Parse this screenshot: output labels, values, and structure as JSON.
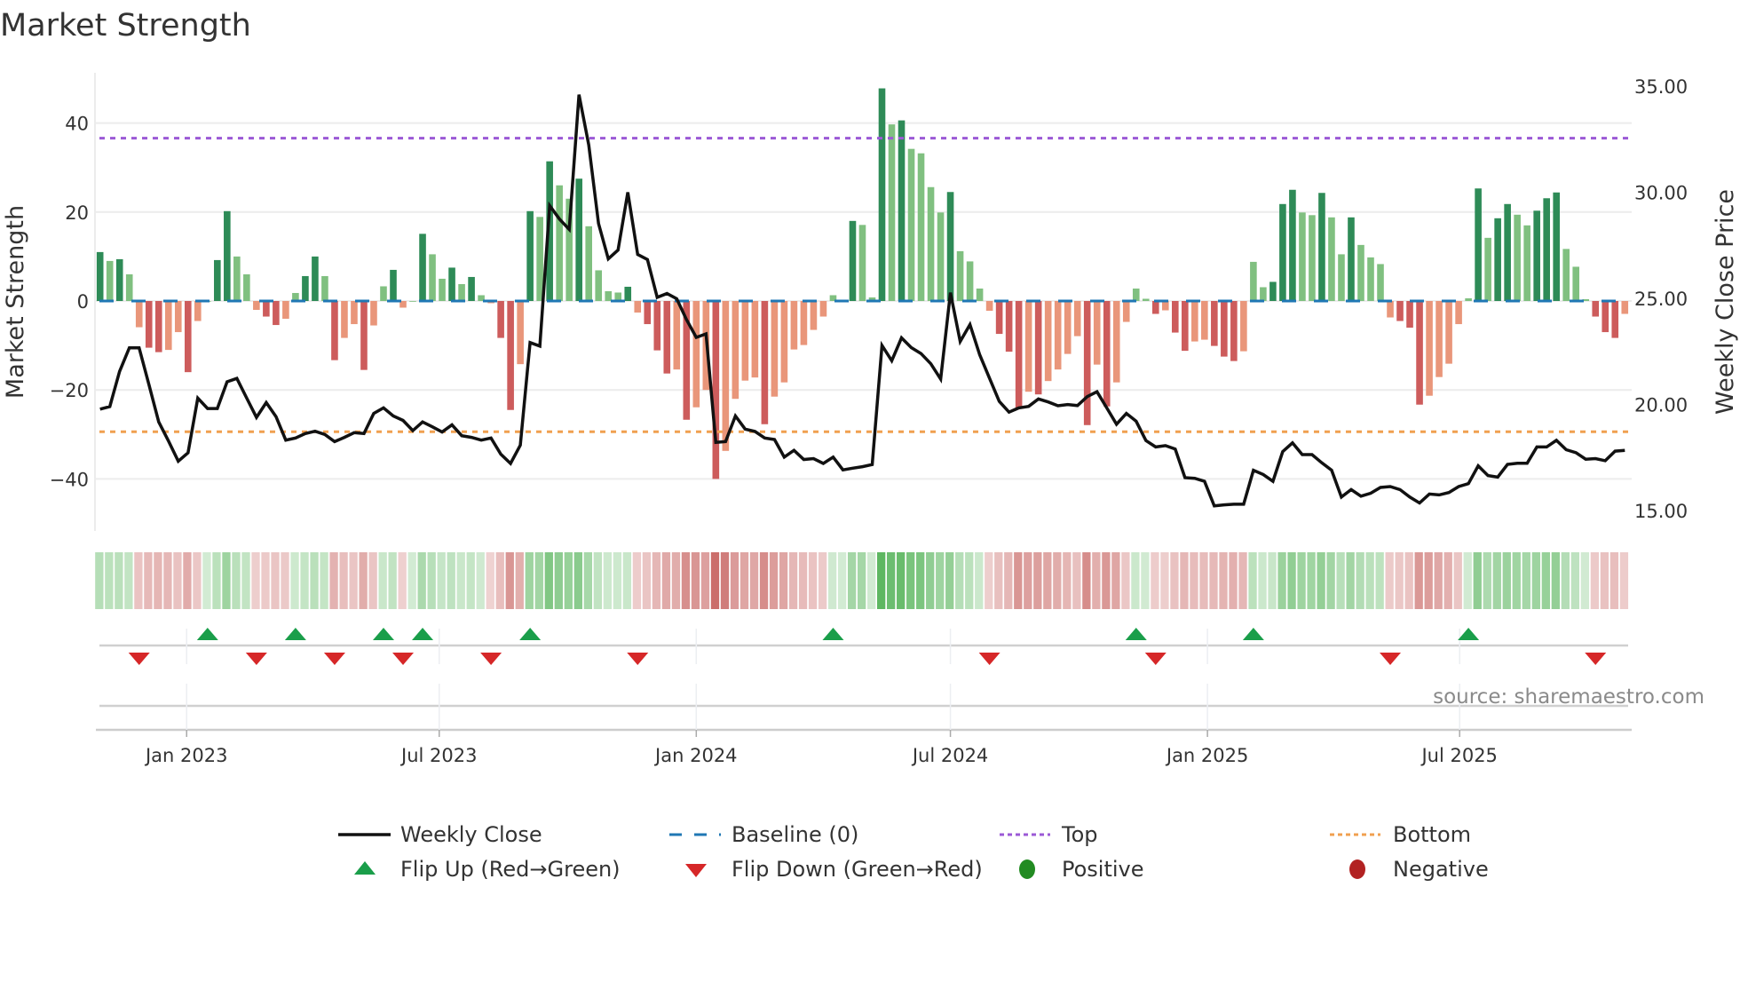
{
  "chart_data": {
    "type": "bar",
    "title": "Market Strength",
    "ylabel": "Market Strength",
    "y2label": "Weekly Close Price",
    "ylim": [
      -51.7,
      51.3
    ],
    "y2lim": [
      14.04,
      35.63
    ],
    "yticks": [
      "40",
      "20",
      "0",
      "−20",
      "−40"
    ],
    "ytick_values": [
      40,
      20,
      0,
      -20,
      -40
    ],
    "y2ticks": [
      "35.00",
      "30.00",
      "25.00",
      "20.00",
      "15.00"
    ],
    "y2tick_values": [
      35,
      30,
      25,
      20,
      15
    ],
    "x_start": "2022-10-31",
    "x_step": "weekly",
    "xticks": [
      {
        "label": "Jan 2023",
        "week": 8.86
      },
      {
        "label": "Jul 2023",
        "week": 34.7
      },
      {
        "label": "Jan 2024",
        "week": 61.0
      },
      {
        "label": "Jul 2024",
        "week": 87.0
      },
      {
        "label": "Jan 2025",
        "week": 113.3
      },
      {
        "label": "Jul 2025",
        "week": 139.1
      }
    ],
    "top_level": 36.6,
    "bottom_level": -29.4,
    "strength": [
      11,
      9,
      9.4,
      6,
      -5.9,
      -10.5,
      -11.5,
      -11,
      -7,
      -16,
      -4.5,
      0,
      9.2,
      20.2,
      10,
      6,
      -2,
      -3.5,
      -5.4,
      -4,
      1.8,
      5.6,
      10,
      5.6,
      -13.3,
      -8.3,
      -5.2,
      -15.5,
      -5.5,
      3.3,
      7,
      -1.5,
      0,
      15.1,
      10.5,
      5,
      7.5,
      3.8,
      5.4,
      1.3,
      -0.5,
      -8.3,
      -24.5,
      -14.2,
      20.2,
      18.9,
      31.4,
      26,
      23,
      27.5,
      16.8,
      6.9,
      2.2,
      1.9,
      3.2,
      -2.6,
      -5.2,
      -11.1,
      -16.3,
      -15.4,
      -26.7,
      -23.9,
      -20,
      -40,
      -33.7,
      -22,
      -17.9,
      -17.2,
      -27.7,
      -21.5,
      -18.3,
      -10.9,
      -9.9,
      -6.5,
      -3.5,
      1.3,
      0.3,
      18,
      17.1,
      0.8,
      47.8,
      39.7,
      40.6,
      34.2,
      33.2,
      25.6,
      19.9,
      24.5,
      11.2,
      8.9,
      2.8,
      -2.2,
      -7.4,
      -11.4,
      -24,
      -20.4,
      -21,
      -18,
      -15.4,
      -11.9,
      -7.9,
      -27.9,
      -14.3,
      -23.7,
      -18.3,
      -4.7,
      2.8,
      0.5,
      -2.9,
      -2.1,
      -7.1,
      -11.2,
      -9.1,
      -8.7,
      -10.1,
      -12.5,
      -13.5,
      -11.3,
      8.8,
      3.1,
      4.3,
      21.8,
      25,
      19.9,
      19.3,
      24.3,
      18.8,
      10.5,
      18.8,
      12.6,
      9.8,
      8.3,
      -3.7,
      -4.5,
      -6,
      -23.3,
      -21.3,
      -17.1,
      -14.1,
      -5.2,
      0.6,
      25.3,
      14.2,
      18.6,
      21.8,
      19.4,
      17,
      20.3,
      23.1,
      24.4,
      11.7,
      7.7,
      0.4,
      -3.5,
      -7,
      -8.3,
      -2.9
    ],
    "close": [
      19.78,
      19.9,
      21.56,
      22.67,
      22.67,
      20.93,
      19.18,
      18.28,
      17.33,
      17.72,
      20.3,
      19.81,
      19.81,
      21.07,
      21.23,
      20.3,
      19.39,
      20.09,
      19.43,
      18.32,
      18.42,
      18.63,
      18.74,
      18.59,
      18.25,
      18.45,
      18.67,
      18.63,
      19.58,
      19.84,
      19.46,
      19.25,
      18.77,
      19.18,
      18.95,
      18.7,
      19.04,
      18.53,
      18.45,
      18.32,
      18.42,
      17.66,
      17.22,
      18.08,
      22.92,
      22.75,
      29.37,
      28.74,
      28.25,
      34.6,
      32.23,
      28.53,
      26.86,
      27.28,
      30,
      27.07,
      26.83,
      25.05,
      25.23,
      24.98,
      24,
      23.16,
      23.33,
      18.21,
      18.25,
      19.46,
      18.84,
      18.73,
      18.42,
      18.35,
      17.52,
      17.84,
      17.41,
      17.45,
      17.22,
      17.52,
      16.92,
      17.0,
      17.07,
      17.17,
      22.78,
      22.06,
      23.14,
      22.68,
      22.4,
      21.92,
      21.2,
      25.27,
      22.97,
      23.77,
      22.34,
      21.24,
      20.15,
      19.64,
      19.84,
      19.91,
      20.26,
      20.12,
      19.94,
      20.0,
      19.95,
      20.37,
      20.6,
      19.84,
      19.07,
      19.58,
      19.21,
      18.3,
      18.0,
      18.06,
      17.9,
      16.55,
      16.52,
      16.38,
      15.22,
      15.27,
      15.3,
      15.3,
      16.9,
      16.7,
      16.38,
      17.78,
      18.19,
      17.64,
      17.64,
      17.25,
      16.9,
      15.64,
      15.99,
      15.68,
      15.82,
      16.09,
      16.13,
      15.99,
      15.64,
      15.36,
      15.78,
      15.74,
      15.85,
      16.13,
      16.27,
      17.11,
      16.65,
      16.58,
      17.18,
      17.23,
      17.23,
      18.0,
      18.0,
      18.31,
      17.87,
      17.73,
      17.42,
      17.45,
      17.35,
      17.8,
      17.84
    ],
    "flip_up_weeks": [
      11,
      20,
      29,
      33,
      44,
      75,
      106,
      118,
      140
    ],
    "flip_down_weeks": [
      4,
      16,
      24,
      31,
      40,
      55,
      91,
      108,
      132,
      153
    ],
    "legend": {
      "placement": "bottom",
      "weekly_close": "Weekly Close",
      "baseline": "Baseline (0)",
      "top": "Top",
      "bottom": "Bottom",
      "flip_up": "Flip Up (Red→Green)",
      "flip_down": "Flip Down (Green→Red)",
      "positive": "Positive",
      "negative": "Negative"
    },
    "source": "source: sharemaestro.com",
    "colors": {
      "pos_strong": "#2e8b57",
      "pos_weak": "#80c080",
      "neg_strong": "#cd5c5c",
      "neg_weak": "#e9967a",
      "baseline": "#1f77b4",
      "top": "#9b59d6",
      "bottom": "#f0a050",
      "close": "#111111",
      "flip_up": "#1a9e4a",
      "flip_down": "#d62728",
      "positive": "#228b22",
      "negative": "#b22222",
      "strip_pos": "#4caf50",
      "strip_neg": "#c0504d"
    }
  }
}
